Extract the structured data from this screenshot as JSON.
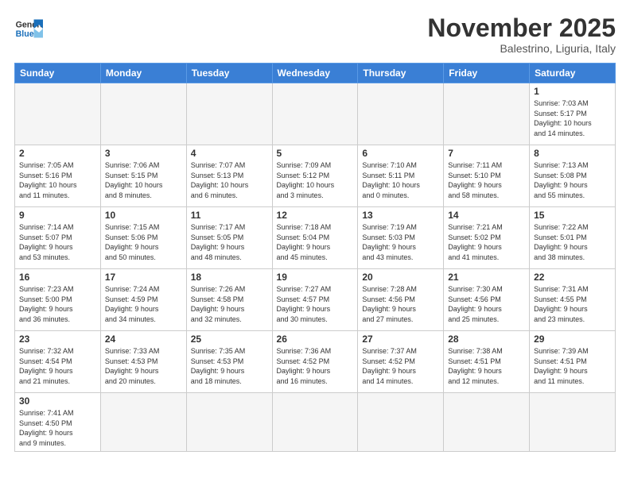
{
  "header": {
    "logo_general": "General",
    "logo_blue": "Blue",
    "month_title": "November 2025",
    "location": "Balestrino, Liguria, Italy"
  },
  "weekdays": [
    "Sunday",
    "Monday",
    "Tuesday",
    "Wednesday",
    "Thursday",
    "Friday",
    "Saturday"
  ],
  "weeks": [
    [
      {
        "day": "",
        "info": ""
      },
      {
        "day": "",
        "info": ""
      },
      {
        "day": "",
        "info": ""
      },
      {
        "day": "",
        "info": ""
      },
      {
        "day": "",
        "info": ""
      },
      {
        "day": "",
        "info": ""
      },
      {
        "day": "1",
        "info": "Sunrise: 7:03 AM\nSunset: 5:17 PM\nDaylight: 10 hours\nand 14 minutes."
      }
    ],
    [
      {
        "day": "2",
        "info": "Sunrise: 7:05 AM\nSunset: 5:16 PM\nDaylight: 10 hours\nand 11 minutes."
      },
      {
        "day": "3",
        "info": "Sunrise: 7:06 AM\nSunset: 5:15 PM\nDaylight: 10 hours\nand 8 minutes."
      },
      {
        "day": "4",
        "info": "Sunrise: 7:07 AM\nSunset: 5:13 PM\nDaylight: 10 hours\nand 6 minutes."
      },
      {
        "day": "5",
        "info": "Sunrise: 7:09 AM\nSunset: 5:12 PM\nDaylight: 10 hours\nand 3 minutes."
      },
      {
        "day": "6",
        "info": "Sunrise: 7:10 AM\nSunset: 5:11 PM\nDaylight: 10 hours\nand 0 minutes."
      },
      {
        "day": "7",
        "info": "Sunrise: 7:11 AM\nSunset: 5:10 PM\nDaylight: 9 hours\nand 58 minutes."
      },
      {
        "day": "8",
        "info": "Sunrise: 7:13 AM\nSunset: 5:08 PM\nDaylight: 9 hours\nand 55 minutes."
      }
    ],
    [
      {
        "day": "9",
        "info": "Sunrise: 7:14 AM\nSunset: 5:07 PM\nDaylight: 9 hours\nand 53 minutes."
      },
      {
        "day": "10",
        "info": "Sunrise: 7:15 AM\nSunset: 5:06 PM\nDaylight: 9 hours\nand 50 minutes."
      },
      {
        "day": "11",
        "info": "Sunrise: 7:17 AM\nSunset: 5:05 PM\nDaylight: 9 hours\nand 48 minutes."
      },
      {
        "day": "12",
        "info": "Sunrise: 7:18 AM\nSunset: 5:04 PM\nDaylight: 9 hours\nand 45 minutes."
      },
      {
        "day": "13",
        "info": "Sunrise: 7:19 AM\nSunset: 5:03 PM\nDaylight: 9 hours\nand 43 minutes."
      },
      {
        "day": "14",
        "info": "Sunrise: 7:21 AM\nSunset: 5:02 PM\nDaylight: 9 hours\nand 41 minutes."
      },
      {
        "day": "15",
        "info": "Sunrise: 7:22 AM\nSunset: 5:01 PM\nDaylight: 9 hours\nand 38 minutes."
      }
    ],
    [
      {
        "day": "16",
        "info": "Sunrise: 7:23 AM\nSunset: 5:00 PM\nDaylight: 9 hours\nand 36 minutes."
      },
      {
        "day": "17",
        "info": "Sunrise: 7:24 AM\nSunset: 4:59 PM\nDaylight: 9 hours\nand 34 minutes."
      },
      {
        "day": "18",
        "info": "Sunrise: 7:26 AM\nSunset: 4:58 PM\nDaylight: 9 hours\nand 32 minutes."
      },
      {
        "day": "19",
        "info": "Sunrise: 7:27 AM\nSunset: 4:57 PM\nDaylight: 9 hours\nand 30 minutes."
      },
      {
        "day": "20",
        "info": "Sunrise: 7:28 AM\nSunset: 4:56 PM\nDaylight: 9 hours\nand 27 minutes."
      },
      {
        "day": "21",
        "info": "Sunrise: 7:30 AM\nSunset: 4:56 PM\nDaylight: 9 hours\nand 25 minutes."
      },
      {
        "day": "22",
        "info": "Sunrise: 7:31 AM\nSunset: 4:55 PM\nDaylight: 9 hours\nand 23 minutes."
      }
    ],
    [
      {
        "day": "23",
        "info": "Sunrise: 7:32 AM\nSunset: 4:54 PM\nDaylight: 9 hours\nand 21 minutes."
      },
      {
        "day": "24",
        "info": "Sunrise: 7:33 AM\nSunset: 4:53 PM\nDaylight: 9 hours\nand 20 minutes."
      },
      {
        "day": "25",
        "info": "Sunrise: 7:35 AM\nSunset: 4:53 PM\nDaylight: 9 hours\nand 18 minutes."
      },
      {
        "day": "26",
        "info": "Sunrise: 7:36 AM\nSunset: 4:52 PM\nDaylight: 9 hours\nand 16 minutes."
      },
      {
        "day": "27",
        "info": "Sunrise: 7:37 AM\nSunset: 4:52 PM\nDaylight: 9 hours\nand 14 minutes."
      },
      {
        "day": "28",
        "info": "Sunrise: 7:38 AM\nSunset: 4:51 PM\nDaylight: 9 hours\nand 12 minutes."
      },
      {
        "day": "29",
        "info": "Sunrise: 7:39 AM\nSunset: 4:51 PM\nDaylight: 9 hours\nand 11 minutes."
      }
    ],
    [
      {
        "day": "30",
        "info": "Sunrise: 7:41 AM\nSunset: 4:50 PM\nDaylight: 9 hours\nand 9 minutes."
      },
      {
        "day": "",
        "info": ""
      },
      {
        "day": "",
        "info": ""
      },
      {
        "day": "",
        "info": ""
      },
      {
        "day": "",
        "info": ""
      },
      {
        "day": "",
        "info": ""
      },
      {
        "day": "",
        "info": ""
      }
    ]
  ]
}
